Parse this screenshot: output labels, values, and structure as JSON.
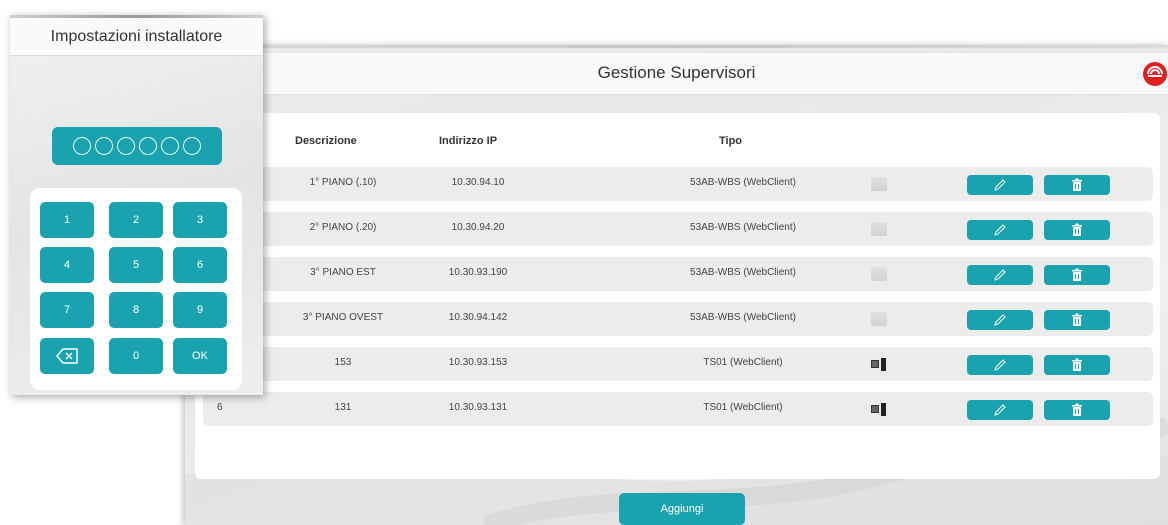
{
  "main_window": {
    "title": "Gestione Supervisori",
    "columns": {
      "descrizione": "Descrizione",
      "indirizzo_ip": "Indirizzo IP",
      "tipo": "Tipo"
    },
    "rows": [
      {
        "num": "",
        "descrizione": "1° PIANO (.10)",
        "ip": "10.30.94.10",
        "tipo": "53AB-WBS (WebClient)",
        "device_icon": "wall-panel-icon"
      },
      {
        "num": "",
        "descrizione": "2° PIANO (.20)",
        "ip": "10.30.94.20",
        "tipo": "53AB-WBS (WebClient)",
        "device_icon": "wall-panel-icon"
      },
      {
        "num": "",
        "descrizione": "3° PIANO EST",
        "ip": "10.30.93.190",
        "tipo": "53AB-WBS (WebClient)",
        "device_icon": "wall-panel-icon"
      },
      {
        "num": "",
        "descrizione": "3° PIANO OVEST",
        "ip": "10.30.94.142",
        "tipo": "53AB-WBS (WebClient)",
        "device_icon": "wall-panel-icon"
      },
      {
        "num": "",
        "descrizione": "153",
        "ip": "10.30.93.153",
        "tipo": "TS01 (WebClient)",
        "device_icon": "touchscreen-icon"
      },
      {
        "num": "6",
        "descrizione": "131",
        "ip": "10.30.93.131",
        "tipo": "TS01 (WebClient)",
        "device_icon": "touchscreen-icon"
      }
    ],
    "add_button": "Aggiungi"
  },
  "keypad_window": {
    "title": "Impostazioni installatore",
    "pin_slots": 6,
    "keys": [
      "1",
      "2",
      "3",
      "4",
      "5",
      "6",
      "7",
      "8",
      "9",
      "backspace",
      "0",
      "OK"
    ]
  },
  "colors": {
    "accent": "#1aa3ae",
    "row_bg": "#ececec",
    "logo_red": "#e02020"
  }
}
